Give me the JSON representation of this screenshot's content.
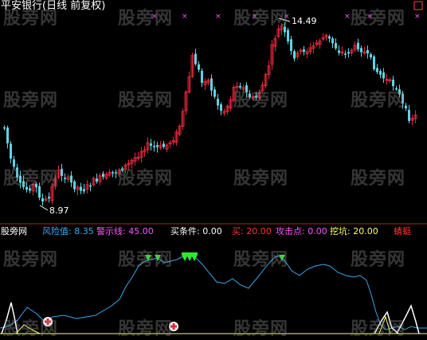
{
  "header": {
    "title": "平安银行(日线 前复权)"
  },
  "price": {
    "high_label": "14.49",
    "low_label": "8.97"
  },
  "indicators": {
    "name": "股旁网",
    "items": [
      {
        "label": "风险值: 8.35",
        "color": "#3fa9f5"
      },
      {
        "label": "警示线: 45.00",
        "color": "#ff55ff"
      },
      {
        "label": "买条件: 0.00",
        "color": "#ffffff"
      },
      {
        "label": "买: 20.00",
        "color": "#ff3333"
      },
      {
        "label": "攻击点: 0.00",
        "color": "#ff55ff"
      },
      {
        "label": "挖坑: 20.00",
        "color": "#ffff66"
      },
      {
        "label": "蜻蜓",
        "color": "#ff3333"
      }
    ]
  },
  "watermark": "股旁网",
  "colors": {
    "up": "#e0283a",
    "down": "#5fd3e6",
    "risk_line": "#3aa6e8",
    "warn_line": "#ffff66"
  }
}
